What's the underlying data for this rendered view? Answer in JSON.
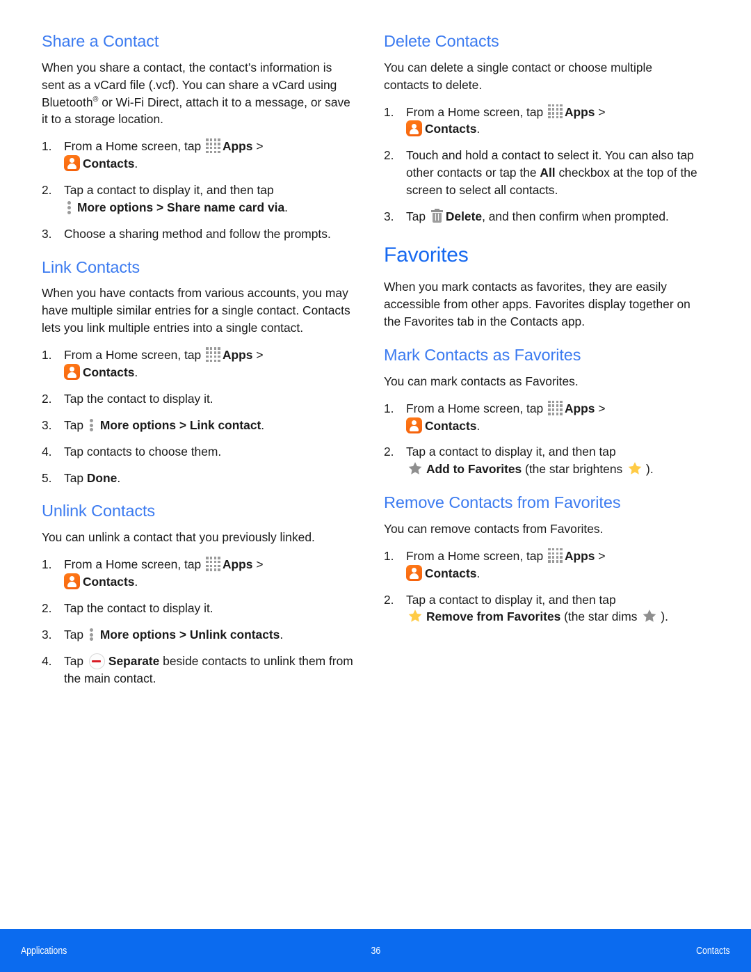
{
  "document": {
    "page_number": "36",
    "footer_left": "Applications",
    "footer_right": "Contacts"
  },
  "colors": {
    "heading_blue": "#3C7BF0",
    "section_blue": "#1769F0",
    "footer_blue": "#0B6BEF",
    "contacts_orange": "#F4600B",
    "star_gold": "#FFCB45",
    "star_gray": "#8F8F8F",
    "separate_red": "#D81B25"
  },
  "left_column": {
    "share_contact": {
      "heading": "Share a Contact",
      "intro_part1": "When you share a contact, the contact’s information is sent as a vCard file (.vcf). You can share a vCard using Bluetooth",
      "intro_sup": "®",
      "intro_part2": " or Wi-Fi Direct, attach it to a message, or save it to a storage location.",
      "steps": [
        {
          "num": "1.",
          "pre": "From a Home screen, tap ",
          "apps_label": "Apps",
          "mid": " > ",
          "contacts_label": "Contacts",
          "post": "."
        },
        {
          "num": "2.",
          "pre": "Tap a contact to display it, and then tap ",
          "more_label": "More options > Share name card via",
          "post": "."
        },
        {
          "num": "3.",
          "pre": "Choose a sharing method and follow the prompts."
        }
      ]
    },
    "link_contacts": {
      "heading": "Link Contacts",
      "intro": "When you have contacts from various accounts, you may have multiple similar entries for a single contact. Contacts lets you link multiple entries into a single contact.",
      "steps": [
        {
          "num": "1.",
          "pre": "From a Home screen, tap ",
          "apps_label": "Apps",
          "mid": " > ",
          "contacts_label": "Contacts",
          "post": "."
        },
        {
          "num": "2.",
          "pre": "Tap the contact to display it."
        },
        {
          "num": "3.",
          "pre": "Tap ",
          "more_label": "More options > Link contact",
          "post": "."
        },
        {
          "num": "4.",
          "pre": "Tap contacts to choose them."
        },
        {
          "num": "5.",
          "pre": "Tap ",
          "bold": "Done",
          "post": "."
        }
      ]
    },
    "unlink_contacts": {
      "heading": "Unlink Contacts",
      "intro": "You can unlink a contact that you previously linked.",
      "steps": [
        {
          "num": "1.",
          "pre": "From a Home screen, tap ",
          "apps_label": "Apps",
          "mid": " > ",
          "contacts_label": "Contacts",
          "post": "."
        },
        {
          "num": "2.",
          "pre": "Tap the contact to display it."
        },
        {
          "num": "3.",
          "pre": "Tap ",
          "more_label": "More options > Unlink contacts",
          "post": "."
        },
        {
          "num": "4.",
          "pre": "Tap ",
          "bold": "Separate",
          "post": " beside contacts to unlink them from the main contact."
        }
      ]
    }
  },
  "right_column": {
    "delete_contacts": {
      "heading": "Delete Contacts",
      "intro": "You can delete a single contact or choose multiple contacts to delete.",
      "steps": [
        {
          "num": "1.",
          "pre": "From a Home screen, tap ",
          "apps_label": "Apps",
          "mid": " > ",
          "contacts_label": "Contacts",
          "post": "."
        },
        {
          "num": "2.",
          "pre": "Touch and hold a contact to select it. You can also tap other contacts or tap the ",
          "bold": "All",
          "post": " checkbox at the top of the screen to select all contacts."
        },
        {
          "num": "3.",
          "pre": "Tap ",
          "bold": "Delete",
          "post": ", and then confirm when prompted."
        }
      ]
    },
    "favorites": {
      "heading": "Favorites",
      "intro": "When you mark contacts as favorites, they are easily accessible from other apps. Favorites display together on the Favorites tab in the Contacts app."
    },
    "mark_favorites": {
      "heading": "Mark Contacts as Favorites",
      "intro": "You can mark contacts as Favorites.",
      "steps": [
        {
          "num": "1.",
          "pre": "From a Home screen, tap ",
          "apps_label": "Apps",
          "mid": " > ",
          "contacts_label": "Contacts",
          "post": "."
        },
        {
          "num": "2.",
          "pre": "Tap a contact to display it, and then tap ",
          "bold": "Add to Favorites",
          "mid": " (the star brightens ",
          "post": ")."
        }
      ]
    },
    "remove_favorites": {
      "heading": "Remove Contacts from Favorites",
      "intro": "You can remove contacts from Favorites.",
      "steps": [
        {
          "num": "1.",
          "pre": "From a Home screen, tap ",
          "apps_label": "Apps",
          "mid": " > ",
          "contacts_label": "Contacts",
          "post": "."
        },
        {
          "num": "2.",
          "pre": "Tap a contact to display it, and then tap ",
          "bold": "Remove from Favorites",
          "mid": " (the star dims ",
          "post": ")."
        }
      ]
    }
  }
}
